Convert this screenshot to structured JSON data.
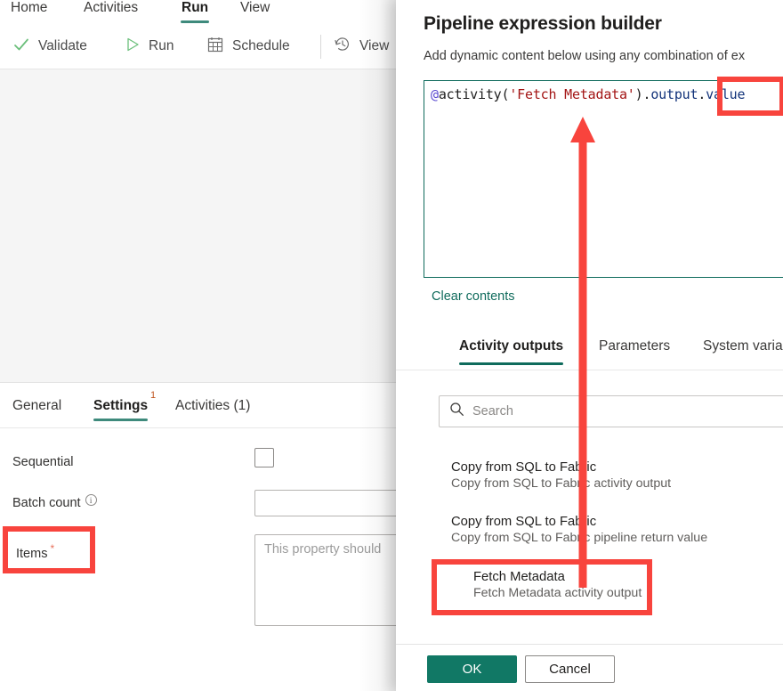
{
  "app": {
    "ribbon_tabs": [
      {
        "label": "Home",
        "active": false
      },
      {
        "label": "Activities",
        "active": false
      },
      {
        "label": "Run",
        "active": true
      },
      {
        "label": "View",
        "active": false
      }
    ],
    "ribbon_commands": [
      {
        "label": "Validate",
        "icon": "checkmark-icon"
      },
      {
        "label": "Run",
        "icon": "play-icon"
      },
      {
        "label": "Schedule",
        "icon": "calendar-icon"
      },
      {
        "label": "View",
        "icon": "history-icon"
      }
    ]
  },
  "properties": {
    "tabs": [
      {
        "label": "General",
        "active": false,
        "superscript": ""
      },
      {
        "label": "Settings",
        "active": true,
        "superscript": "1"
      },
      {
        "label": "Activities (1)",
        "active": false,
        "superscript": ""
      }
    ],
    "fields": {
      "sequential_label": "Sequential",
      "batch_count_label": "Batch count",
      "batch_count_value": "",
      "items_label": "Items",
      "items_required_marker": "*",
      "items_placeholder": "This property should"
    }
  },
  "dialog": {
    "title": "Pipeline expression builder",
    "subtitle": "Add dynamic content below using any combination of ex",
    "expression": {
      "full": "@activity('Fetch Metadata').output.value",
      "tokens": [
        {
          "text": "@",
          "kind": "at"
        },
        {
          "text": "activity",
          "kind": "fn"
        },
        {
          "text": "(",
          "kind": "paren"
        },
        {
          "text": "'Fetch Metadata'",
          "kind": "str"
        },
        {
          "text": ")",
          "kind": "paren"
        },
        {
          "text": ".",
          "kind": "dot"
        },
        {
          "text": "output",
          "kind": "prop"
        },
        {
          "text": ".",
          "kind": "dot"
        },
        {
          "text": "value",
          "kind": "prop"
        }
      ]
    },
    "clear_contents_label": "Clear contents",
    "tabs": [
      {
        "label": "Activity outputs",
        "active": true
      },
      {
        "label": "Parameters",
        "active": false
      },
      {
        "label": "System varia",
        "active": false
      }
    ],
    "search_placeholder": "Search",
    "outputs": [
      {
        "title": "Copy from SQL to Fabric",
        "desc": "Copy from SQL to Fabric activity output"
      },
      {
        "title": "Copy from SQL to Fabric",
        "desc": "Copy from SQL to Fabric pipeline return value"
      },
      {
        "title": "Fetch Metadata",
        "desc": "Fetch Metadata activity output"
      }
    ],
    "ok_label": "OK",
    "cancel_label": "Cancel"
  },
  "colors": {
    "accent_teal": "#117865",
    "tab_underline": "#3e8a7c",
    "annotation_red": "#f8443d",
    "canvas_gray": "#f5f5f5",
    "required_star": "#e8705a"
  },
  "annotations": {
    "items_highlight": "Items",
    "value_highlight": ".value",
    "fetch_metadata_highlight": "Fetch Metadata",
    "arrow": "red-up-arrow"
  }
}
